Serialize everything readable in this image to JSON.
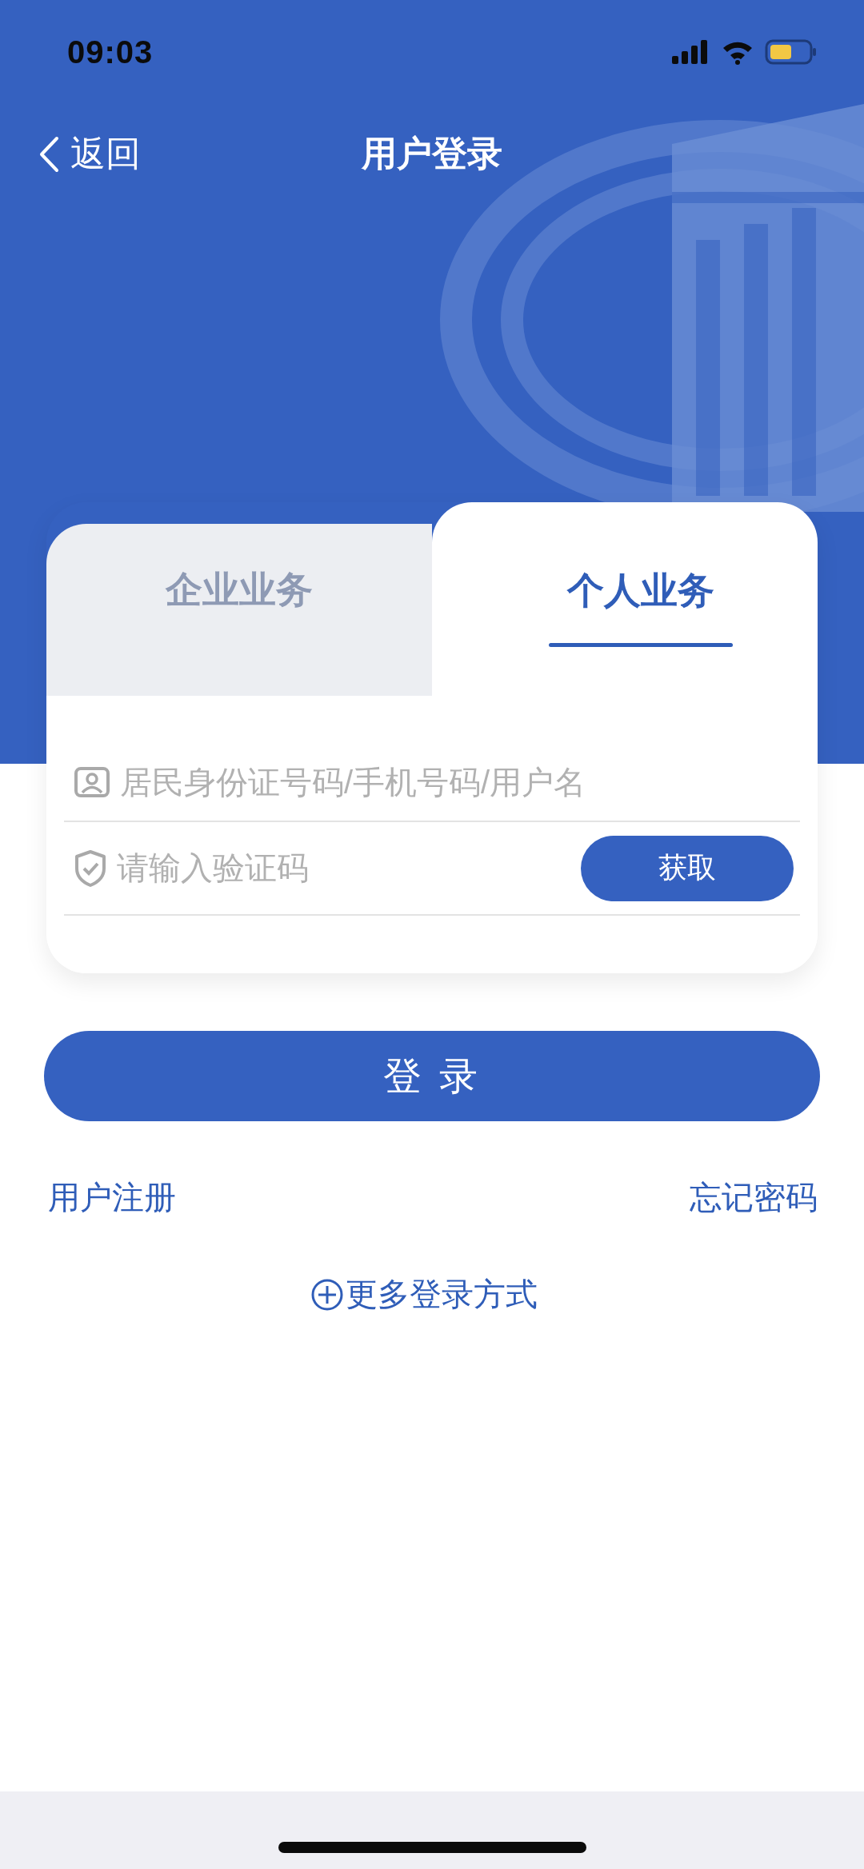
{
  "status_bar": {
    "time": "09:03"
  },
  "header": {
    "back": "返回",
    "title": "用户登录"
  },
  "tabs": [
    {
      "label": "企业业务",
      "selected": false
    },
    {
      "label": "个人业务",
      "selected": true
    }
  ],
  "fields": [
    {
      "kind": "account",
      "placeholder": "居民身份证号码/手机号码/用户名"
    },
    {
      "kind": "code",
      "placeholder": "请输入验证码",
      "button": "获取"
    }
  ],
  "login_button": "登 录",
  "links": [
    "用户注册",
    "忘记密码"
  ],
  "more_login": "更多登录方式"
}
